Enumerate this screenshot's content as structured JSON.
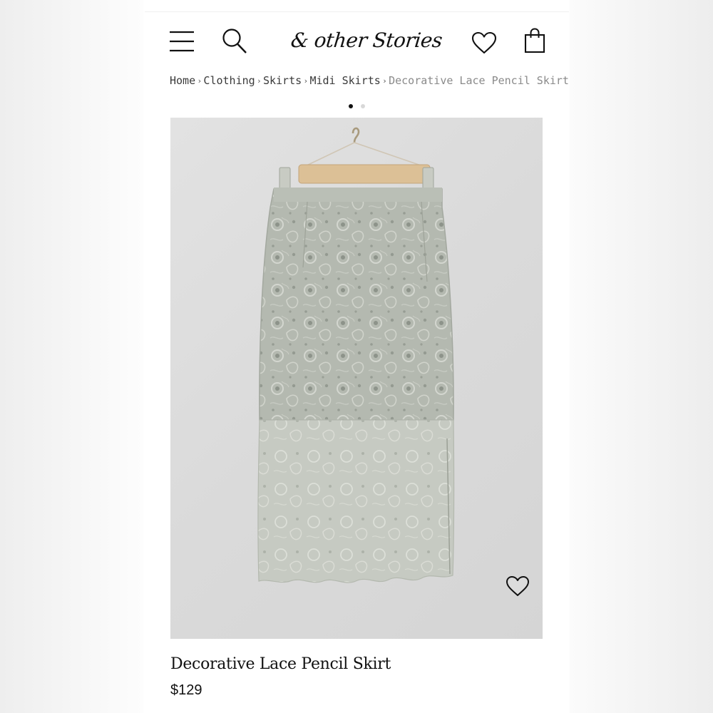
{
  "header": {
    "logo_text": "& other Stories",
    "icons": [
      "menu-icon",
      "search-icon",
      "heart-icon",
      "shopping-bag-icon"
    ]
  },
  "breadcrumb": {
    "items": [
      "Home",
      "Clothing",
      "Skirts",
      "Midi Skirts",
      "Decorative Lace Pencil Skirt"
    ],
    "separator": "›"
  },
  "carousel": {
    "total_images": 2,
    "active_index": 0
  },
  "product": {
    "name": "Decorative Lace Pencil Skirt",
    "price": "$129",
    "image_background": "#dddddd",
    "lace_color": "#b3b8af",
    "hanger_color": "#dcc096"
  }
}
